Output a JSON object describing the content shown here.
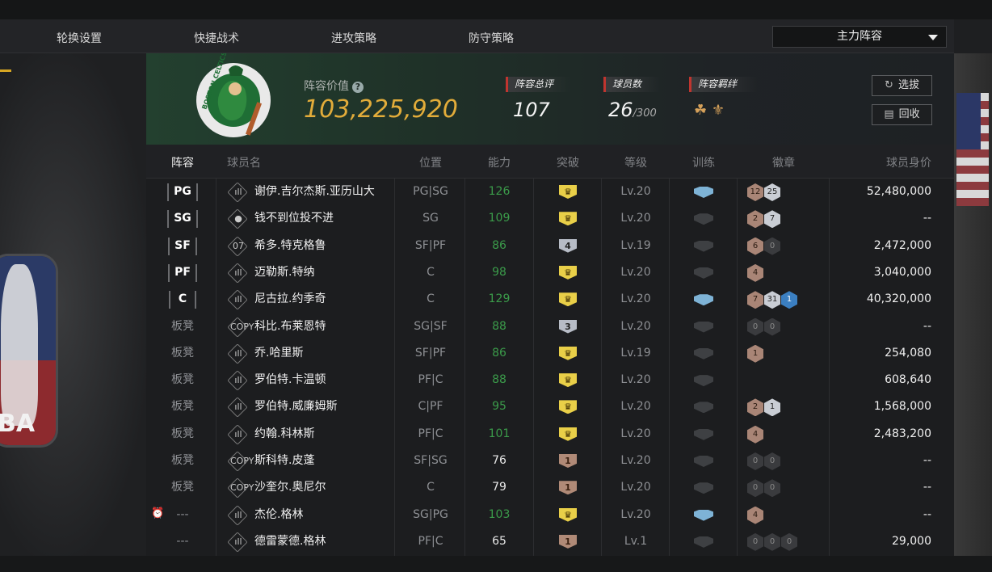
{
  "tabs": [
    "轮换设置",
    "快捷战术",
    "进攻策略",
    "防守策略"
  ],
  "lineup_dropdown": {
    "selected": "主力阵容",
    "icon": "chevron-down-icon"
  },
  "header": {
    "team_logo_text": "BOSTON CELTICS",
    "value_label": "阵容价值",
    "value": "103,225,920",
    "rating_label": "阵容总评",
    "rating": "107",
    "player_count_label": "球员数",
    "player_count": "26",
    "player_count_max": "/300",
    "bond_label": "阵容羁绊",
    "select_button": "选拔",
    "recycle_button": "回收"
  },
  "columns": [
    "阵容",
    "球员名",
    "位置",
    "能力",
    "突破",
    "等级",
    "训练",
    "徽章",
    "球员身价"
  ],
  "players": [
    {
      "slot": "PG",
      "starter": true,
      "icon": "signal-icon",
      "name": "谢伊.吉尔杰斯.亚历山大",
      "position": "PG|SG",
      "ability": "126",
      "ability_color": "green",
      "breakthrough": "gold",
      "bt_label": "",
      "level": "Lv.20",
      "training": true,
      "badges": [
        [
          "b",
          "12"
        ],
        [
          "s",
          "25"
        ]
      ],
      "price": "52,480,000"
    },
    {
      "slot": "SG",
      "starter": true,
      "icon": "person-icon",
      "name": "钱不到位投不进",
      "position": "SG",
      "ability": "109",
      "ability_color": "green",
      "breakthrough": "gold",
      "bt_label": "",
      "level": "Lv.20",
      "training": false,
      "badges": [
        [
          "b",
          "2"
        ],
        [
          "s",
          "7"
        ]
      ],
      "price": "--"
    },
    {
      "slot": "SF",
      "starter": true,
      "icon": "07",
      "name": "希多.特克格鲁",
      "position": "SF|PF",
      "ability": "86",
      "ability_color": "green",
      "breakthrough": "silver",
      "bt_label": "4",
      "level": "Lv.19",
      "training": false,
      "badges": [
        [
          "b",
          "6"
        ],
        [
          "d",
          "0"
        ]
      ],
      "price": "2,472,000"
    },
    {
      "slot": "PF",
      "starter": true,
      "icon": "signal-icon",
      "name": "迈勒斯.特纳",
      "position": "C",
      "ability": "98",
      "ability_color": "green",
      "breakthrough": "gold",
      "bt_label": "",
      "level": "Lv.20",
      "training": false,
      "badges": [
        [
          "b",
          "4"
        ]
      ],
      "price": "3,040,000"
    },
    {
      "slot": "C",
      "starter": true,
      "icon": "signal-icon",
      "name": "尼古拉.约季奇",
      "position": "C",
      "ability": "129",
      "ability_color": "green",
      "breakthrough": "gold",
      "bt_label": "",
      "level": "Lv.20",
      "training": true,
      "badges": [
        [
          "b",
          "7"
        ],
        [
          "s",
          "31"
        ],
        [
          "u",
          "1"
        ]
      ],
      "price": "40,320,000"
    },
    {
      "slot": "板凳",
      "starter": false,
      "icon": "COPY",
      "name": "科比.布莱恩特",
      "position": "SG|SF",
      "ability": "88",
      "ability_color": "green",
      "breakthrough": "silver",
      "bt_label": "3",
      "level": "Lv.20",
      "training": false,
      "badges": [
        [
          "d",
          "0"
        ],
        [
          "d",
          "0"
        ]
      ],
      "price": "--"
    },
    {
      "slot": "板凳",
      "starter": false,
      "icon": "signal-icon",
      "name": "乔.哈里斯",
      "position": "SF|PF",
      "ability": "86",
      "ability_color": "green",
      "breakthrough": "gold",
      "bt_label": "",
      "level": "Lv.19",
      "training": false,
      "badges": [
        [
          "b",
          "1"
        ]
      ],
      "price": "254,080"
    },
    {
      "slot": "板凳",
      "starter": false,
      "icon": "signal-icon",
      "name": "罗伯特.卡温顿",
      "position": "PF|C",
      "ability": "88",
      "ability_color": "green",
      "breakthrough": "gold",
      "bt_label": "",
      "level": "Lv.20",
      "training": false,
      "badges": [],
      "price": "608,640"
    },
    {
      "slot": "板凳",
      "starter": false,
      "icon": "signal-icon",
      "name": "罗伯特.威廉姆斯",
      "position": "C|PF",
      "ability": "95",
      "ability_color": "green",
      "breakthrough": "gold",
      "bt_label": "",
      "level": "Lv.20",
      "training": false,
      "badges": [
        [
          "b",
          "2"
        ],
        [
          "s",
          "1"
        ]
      ],
      "price": "1,568,000"
    },
    {
      "slot": "板凳",
      "starter": false,
      "icon": "signal-icon",
      "name": "约翰.科林斯",
      "position": "PF|C",
      "ability": "101",
      "ability_color": "green",
      "breakthrough": "gold",
      "bt_label": "",
      "level": "Lv.20",
      "training": false,
      "badges": [
        [
          "b",
          "4"
        ]
      ],
      "price": "2,483,200"
    },
    {
      "slot": "板凳",
      "starter": false,
      "icon": "COPY",
      "name": "斯科特.皮蓬",
      "position": "SF|SG",
      "ability": "76",
      "ability_color": "white",
      "breakthrough": "bronze",
      "bt_label": "1",
      "level": "Lv.20",
      "training": false,
      "badges": [
        [
          "d",
          "0"
        ],
        [
          "d",
          "0"
        ]
      ],
      "price": "--"
    },
    {
      "slot": "板凳",
      "starter": false,
      "icon": "COPY",
      "name": "沙奎尔.奥尼尔",
      "position": "C",
      "ability": "79",
      "ability_color": "white",
      "breakthrough": "bronze",
      "bt_label": "1",
      "level": "Lv.20",
      "training": false,
      "badges": [
        [
          "d",
          "0"
        ],
        [
          "d",
          "0"
        ]
      ],
      "price": "--"
    },
    {
      "slot": "---",
      "starter": false,
      "alarm": true,
      "icon": "signal-icon",
      "name": "杰伦.格林",
      "position": "SG|PG",
      "ability": "103",
      "ability_color": "green",
      "breakthrough": "gold",
      "bt_label": "",
      "level": "Lv.20",
      "training": true,
      "badges": [
        [
          "b",
          "4"
        ]
      ],
      "price": "--"
    },
    {
      "slot": "---",
      "starter": false,
      "icon": "signal-icon",
      "name": "德雷蒙德.格林",
      "position": "PF|C",
      "ability": "65",
      "ability_color": "white",
      "breakthrough": "bronze",
      "bt_label": "1",
      "level": "Lv.1",
      "training": false,
      "badges": [
        [
          "d",
          "0"
        ],
        [
          "d",
          "0"
        ],
        [
          "d",
          "0"
        ]
      ],
      "price": "29,000"
    }
  ]
}
